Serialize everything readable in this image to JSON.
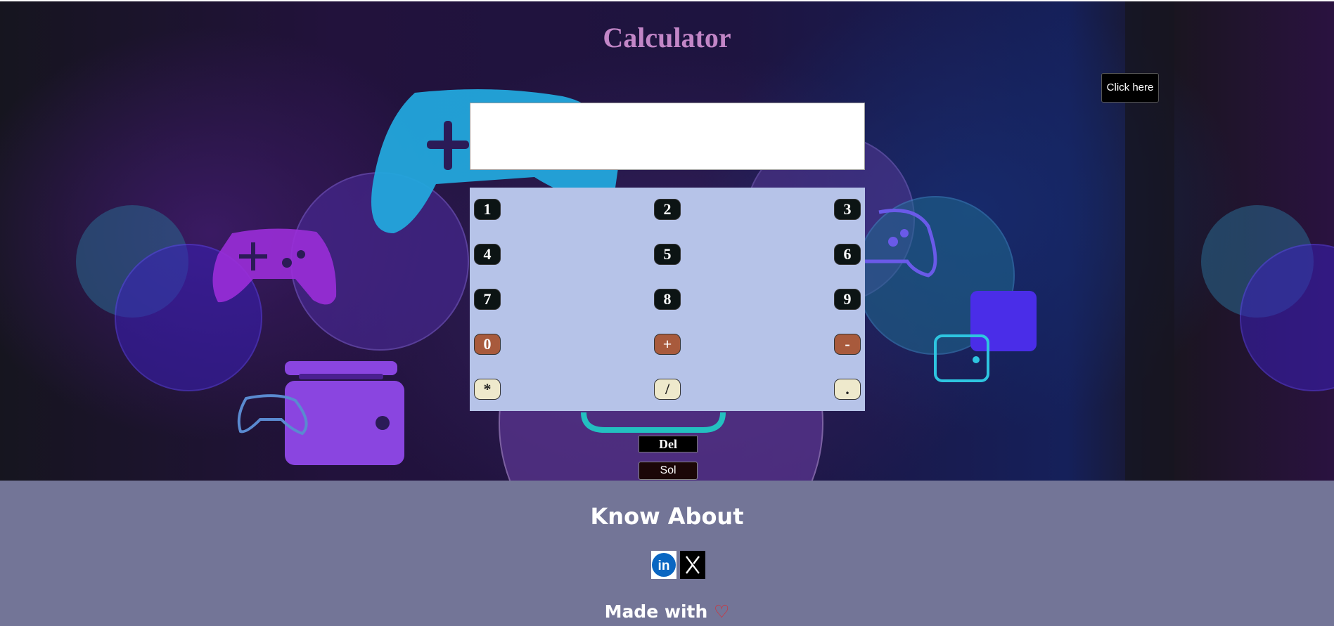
{
  "page": {
    "title": "Calculator"
  },
  "top_button": {
    "label": "Click here"
  },
  "display": {
    "value": ""
  },
  "keys": [
    {
      "label": "1",
      "style": "dark"
    },
    {
      "label": "2",
      "style": "dark"
    },
    {
      "label": "3",
      "style": "dark"
    },
    {
      "label": "4",
      "style": "dark"
    },
    {
      "label": "5",
      "style": "dark"
    },
    {
      "label": "6",
      "style": "dark"
    },
    {
      "label": "7",
      "style": "dark"
    },
    {
      "label": "8",
      "style": "dark"
    },
    {
      "label": "9",
      "style": "dark"
    },
    {
      "label": "0",
      "style": "brown"
    },
    {
      "label": "+",
      "style": "brown"
    },
    {
      "label": "-",
      "style": "brown"
    },
    {
      "label": "*",
      "style": "cream"
    },
    {
      "label": "/",
      "style": "cream"
    },
    {
      "label": ".",
      "style": "cream"
    }
  ],
  "controls": {
    "delete_label": "Del",
    "solve_label": "Sol"
  },
  "footer": {
    "heading": "Know About",
    "social": [
      {
        "icon": "linkedin-icon"
      },
      {
        "icon": "x-icon"
      }
    ],
    "made_with": "Made with",
    "heart_glyph": "♡"
  },
  "colors": {
    "title": "#c286c7",
    "keypad_bg": "#b6c3e8",
    "key_dark": "#0c1414",
    "key_brown": "#a85a3c",
    "key_cream": "#eee9cc",
    "footer_bg": "#737597",
    "heart": "#e0282c"
  }
}
